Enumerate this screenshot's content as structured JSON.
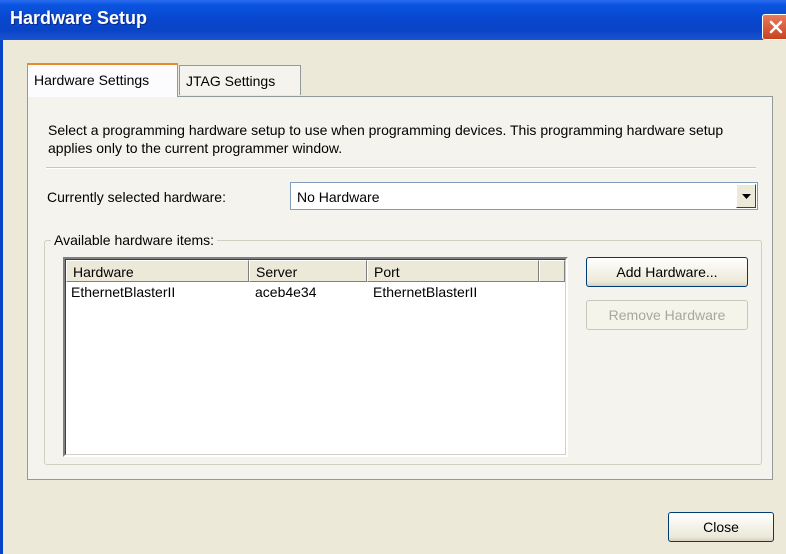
{
  "window": {
    "title": "Hardware Setup"
  },
  "tabs": [
    {
      "label": "Hardware Settings"
    },
    {
      "label": "JTAG Settings"
    }
  ],
  "description": "Select a programming hardware setup to use when programming devices. This programming hardware setup applies only to the current programmer window.",
  "current_hardware": {
    "label": "Currently selected hardware:",
    "value": "No Hardware"
  },
  "available": {
    "label": "Available hardware items:",
    "columns": [
      "Hardware",
      "Server",
      "Port"
    ],
    "rows": [
      [
        "EthernetBlasterII",
        "aceb4e34",
        "EthernetBlasterII"
      ]
    ]
  },
  "buttons": {
    "add": "Add Hardware...",
    "remove": "Remove Hardware",
    "close": "Close"
  },
  "icons": {
    "close": "close-icon",
    "dropdown": "chevron-down-icon"
  }
}
